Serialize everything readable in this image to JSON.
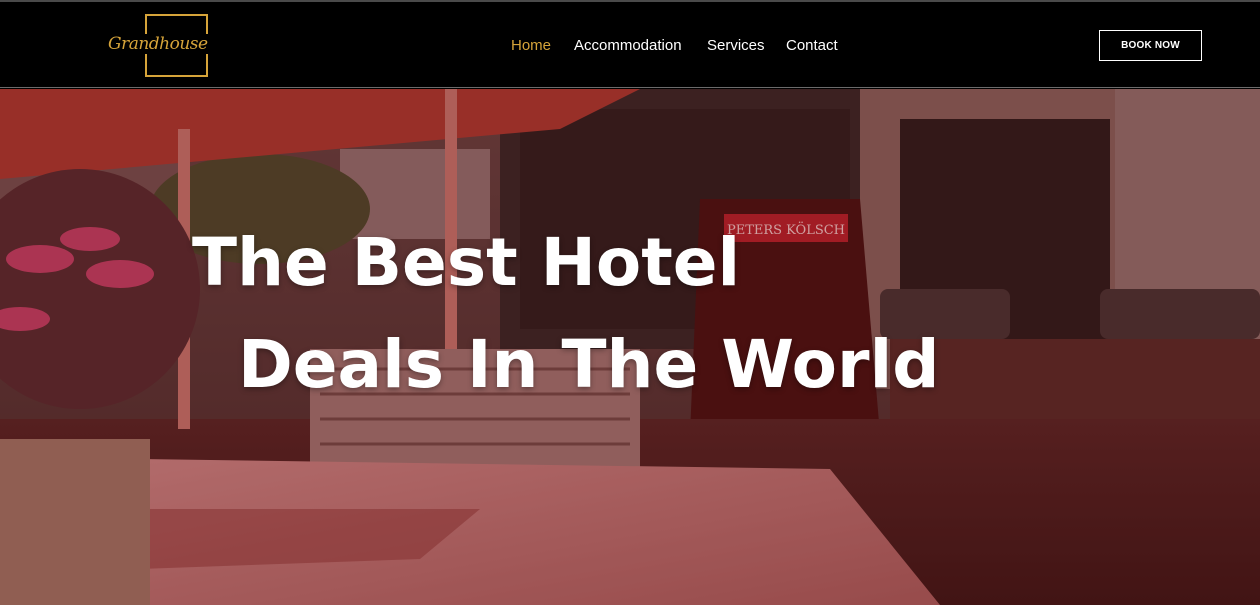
{
  "brand": {
    "logo_text": "Grandhouse"
  },
  "nav": {
    "links": [
      {
        "label": "Home",
        "active": true
      },
      {
        "label": "Accommodation",
        "active": false
      },
      {
        "label": "Services",
        "active": false
      },
      {
        "label": "Contact",
        "active": false
      }
    ],
    "cta_label": "BOOK NOW"
  },
  "hero": {
    "headline_line1": "The Best Hotel",
    "headline_line2": "Deals In The World",
    "sign_text": "PETERS KÖLSCH"
  },
  "colors": {
    "accent": "#d6a43a",
    "nav_bg": "#000000",
    "text": "#ffffff",
    "hero_tint": "#78141a"
  }
}
